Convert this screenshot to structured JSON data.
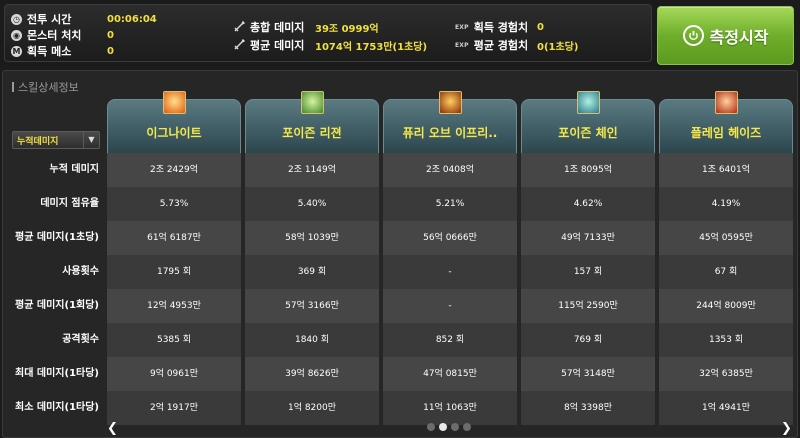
{
  "stats_left": [
    {
      "icon": "clock-icon",
      "icon_glyph": "◷",
      "label": "전투 시간",
      "value": "00:06:04"
    },
    {
      "icon": "monster-icon",
      "icon_glyph": "◉",
      "label": "몬스터 처치",
      "value": "0"
    },
    {
      "icon": "meso-icon",
      "icon_glyph": "M",
      "label": "획득 메소",
      "value": "0"
    }
  ],
  "stats_mid": [
    {
      "icon": "sword-icon",
      "label": "총합 데미지",
      "value": "39조 0999억"
    },
    {
      "icon": "sword-icon",
      "label": "평균 데미지",
      "value": "1074억 1753만(1초당)"
    }
  ],
  "stats_right": [
    {
      "tag": "EXP",
      "label": "획득 경험치",
      "value": "0"
    },
    {
      "tag": "EXP",
      "label": "평균 경험치",
      "value": "0(1초당)"
    }
  ],
  "start_button": {
    "label": "측정시작"
  },
  "section_title": "스킬상세정보",
  "sort_dropdown": {
    "value": "누적데미지"
  },
  "row_labels": [
    "누적 데미지",
    "데미지 점유율",
    "평균 데미지(1초당)",
    "사용횟수",
    "평균 데미지(1회당)",
    "공격횟수",
    "최대 데미지(1타당)",
    "최소 데미지(1타당)"
  ],
  "skills": [
    {
      "name": "이그나이트",
      "icon_colors": [
        "#ffe08a",
        "#e05a10"
      ],
      "values": [
        "2조 2429억",
        "5.73%",
        "61억 6187만",
        "1795 회",
        "12억 4953만",
        "5385 회",
        "9억 0961만",
        "2억 1917만"
      ]
    },
    {
      "name": "포이즌 리젼",
      "icon_colors": [
        "#d8f2a0",
        "#3e8a2a"
      ],
      "values": [
        "2조 1149억",
        "5.40%",
        "58억 1039만",
        "369 회",
        "57억 3166만",
        "1840 회",
        "39억 8626만",
        "1억 8200만"
      ]
    },
    {
      "name": "퓨리 오브 이프리..",
      "icon_colors": [
        "#ffd060",
        "#8a2a08"
      ],
      "values": [
        "2조 0408억",
        "5.21%",
        "56억 0666만",
        "-",
        "-",
        "852 회",
        "47억 0815만",
        "11억 1063만"
      ]
    },
    {
      "name": "포이즌 체인",
      "icon_colors": [
        "#b0f0e0",
        "#2a7a8a"
      ],
      "values": [
        "1조 8095억",
        "4.62%",
        "49억 7133만",
        "157 회",
        "115억 2590만",
        "769 회",
        "57억 3148만",
        "8억 3398만"
      ]
    },
    {
      "name": "플레임 헤이즈",
      "icon_colors": [
        "#ffd0a0",
        "#b02a10"
      ],
      "values": [
        "1조 6401억",
        "4.19%",
        "45억 0595만",
        "67 회",
        "244억 8009만",
        "1353 회",
        "32억 6385만",
        "1억 4941만"
      ]
    }
  ],
  "pager": {
    "prev": "❮",
    "next": "❯",
    "pages": 4,
    "active": 1
  },
  "colors": {
    "value_yellow": "#f0e040",
    "button_green": "#6fae2b",
    "header_teal": "#3a5a62"
  }
}
